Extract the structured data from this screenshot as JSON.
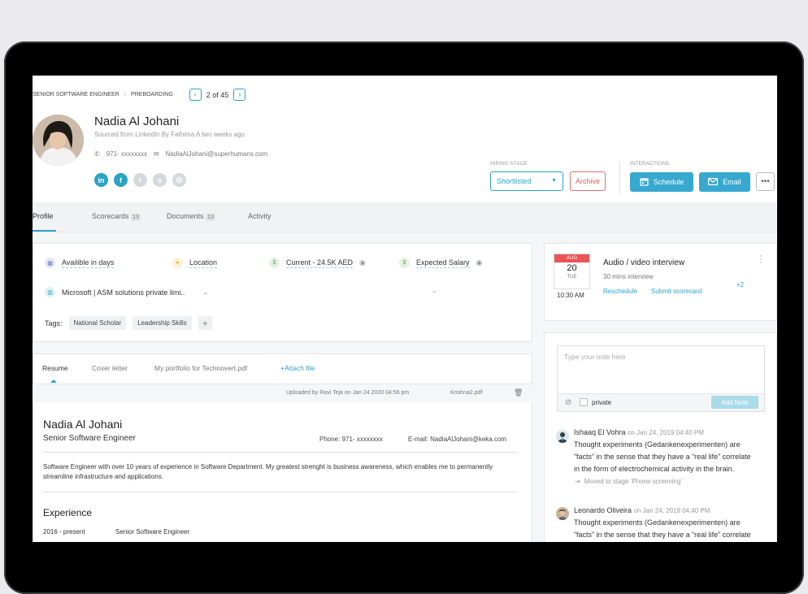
{
  "breadcrumb": {
    "job": "SENIOR SOFTWARE ENGINEER",
    "stage": "PREBOARDING",
    "pager": "2 of 45"
  },
  "candidate": {
    "name": "Nadia Al Johani",
    "source": "Sourced from LinkedIn By Fathima A two weeks ago",
    "phone": "971- xxxxxxxx",
    "email": "NadiaAlJohani@superhumans.com",
    "socials": [
      "linkedin-icon",
      "facebook-icon",
      "twitter-icon",
      "skype-icon",
      "github-icon"
    ]
  },
  "hiring": {
    "label": "HIRING STAGE",
    "stage_value": "Shortlisted",
    "archive_label": "Archive"
  },
  "interactions": {
    "label": "INTERACTIONS",
    "schedule_label": "Schedule",
    "email_label": "Email"
  },
  "tabs": [
    {
      "label": "Profile"
    },
    {
      "label": "Scorecards",
      "count": "13"
    },
    {
      "label": "Documents",
      "count": "13"
    },
    {
      "label": "Activity"
    }
  ],
  "profile": {
    "availability": "Availible in days",
    "location": "Location",
    "current": "Current - 24.5K AED",
    "expected": "Expected Salary",
    "company": "Microsoft | ASM solutions private limi..",
    "tags_label": "Tags:",
    "tags": [
      "National Scholar",
      "Leadership Skills"
    ]
  },
  "resume": {
    "tabs": [
      "Resume",
      "Cover letter",
      "My portfolio for Technovert.pdf",
      "+Attach file"
    ],
    "uploaded": "Uploaded by Ravi Teja on Jan 24 2020 04:56 pm",
    "file": "Krishna2.pdf",
    "name": "Nadia Al Johani",
    "title": "Senior Software Engineer",
    "phone": "Phone: 971- xxxxxxxx",
    "email": "E-mail: NadiaAlJohani@keka.com",
    "summary": "Software Engineer with over 10 years of experience in Software Department. My greatest strenght is business awareness, which enables me to permanently streamline infrastructure and applications.",
    "experience_heading": "Experience",
    "exp_period": "2016 - present",
    "exp_role": "Senior Software Engineer"
  },
  "interview": {
    "month": "AUG",
    "day": "20",
    "weekday": "TUE",
    "time": "10:30 AM",
    "title": "Audio / video interview",
    "duration": "30 mins interview",
    "reschedule": "Reschedule",
    "submit": "Submit scorecard",
    "more": "+2"
  },
  "notes": {
    "placeholder": "Type your note here",
    "private_label": "private",
    "add_label": "Add Note",
    "comments": [
      {
        "author": "Ishaaq El Vohra",
        "time": "on Jan 24, 2019 04:40 PM",
        "lines": [
          "Thought experiments (Gedankenexperimenten) are",
          "“facts” in the sense that they have a “real life” correlate",
          "in the form of electrochemical activity in the brain."
        ],
        "moved": "Moved to stage ‘Phone screening’"
      },
      {
        "author": "Leonardo Oliveira",
        "time": "on Jan 24, 2019 04:40 PM",
        "lines": [
          "Thought experiments (Gedankenexperimenten) are",
          "“facts” in the sense that they have a “real life” correlate"
        ]
      }
    ]
  },
  "colors": {
    "accent": "#2aa3c8",
    "button": "#37a8cf",
    "archive": "#e05a5a"
  }
}
